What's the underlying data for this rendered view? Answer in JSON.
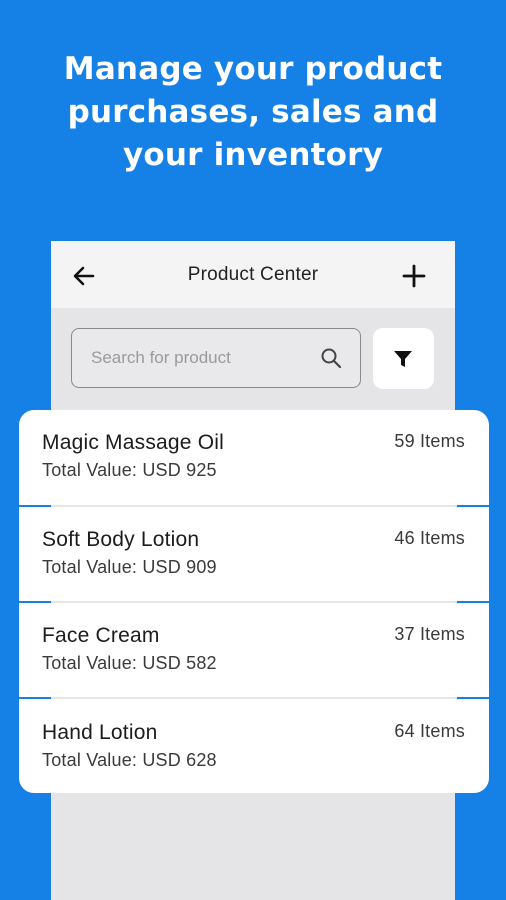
{
  "promo": {
    "headline_lines": [
      "Manage your product",
      "purchases, sales and",
      "your inventory"
    ]
  },
  "app_bar": {
    "title": "Product Center",
    "back_icon": "arrow-left-icon",
    "add_icon": "plus-icon"
  },
  "search": {
    "placeholder": "Search for product",
    "value": "",
    "icon": "search-icon"
  },
  "filter": {
    "icon": "funnel-icon"
  },
  "products": [
    {
      "name": "Magic Massage Oil",
      "total_value": "Total Value: USD 925",
      "count": "59 Items"
    },
    {
      "name": "Soft Body Lotion",
      "total_value": "Total Value: USD 909",
      "count": "46 Items"
    },
    {
      "name": "Face Cream",
      "total_value": "Total Value: USD 582",
      "count": "37 Items"
    },
    {
      "name": "Hand Lotion",
      "total_value": "Total Value: USD 628",
      "count": "64 Items"
    }
  ],
  "colors": {
    "brand_blue": "#1581e6",
    "screen_bg": "#e5e5e7",
    "card_bg": "#ffffff"
  }
}
